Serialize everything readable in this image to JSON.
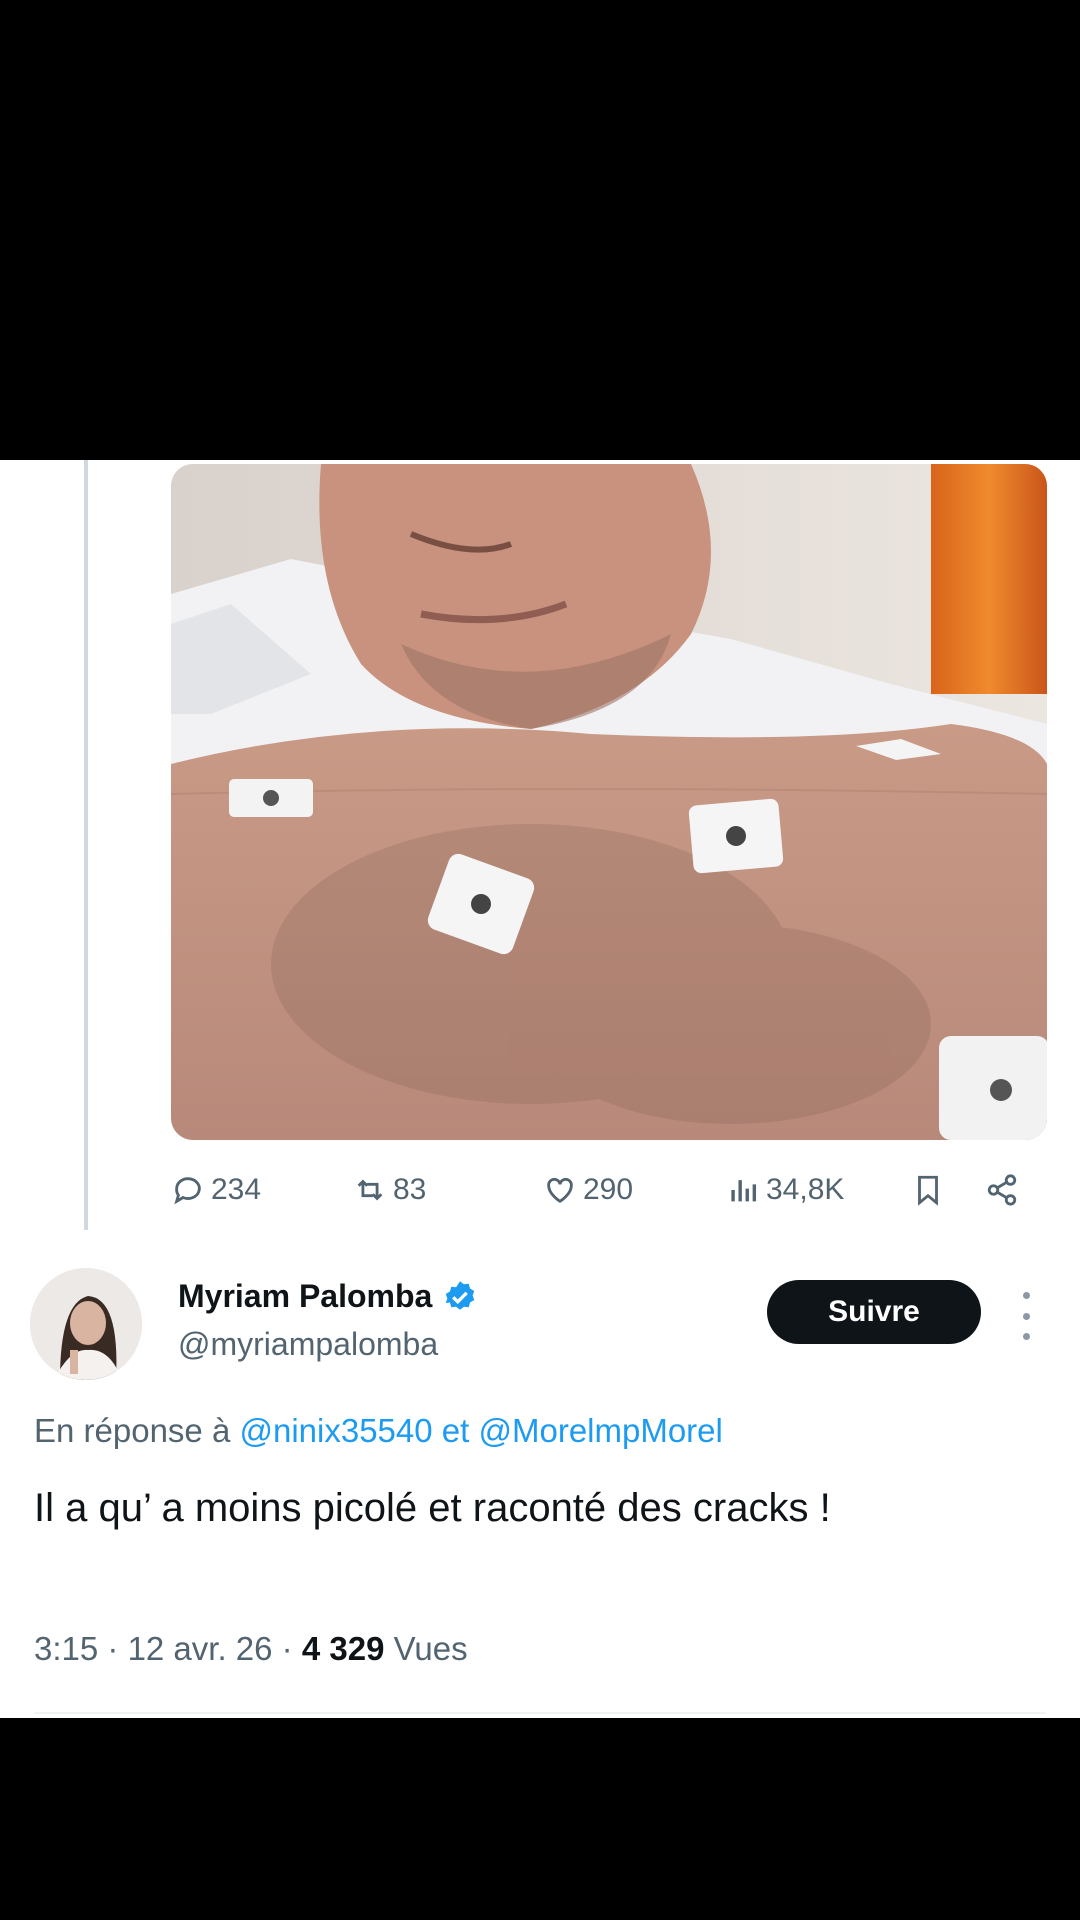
{
  "media": {
    "image_icon": "selfie-ecg-electrodes-photo"
  },
  "actions": {
    "replies": "234",
    "reposts": "83",
    "likes": "290",
    "views": "34,8K"
  },
  "reply_tweet": {
    "author_name": "Myriam Palomba",
    "handle": "@myriampalomba",
    "verified_icon": "verified-badge-icon",
    "follow_label": "Suivre",
    "reply_prefix": "En réponse à ",
    "mention_1": "@ninix35540",
    "connector": " et ",
    "mention_2": "@MorelmpMorel",
    "text": "Il a qu’ a moins picolé et raconté des cracks !",
    "time": "3:15",
    "date": "12 avr. 26",
    "views_count": "4 329",
    "views_label": "Vues"
  },
  "colors": {
    "accent": "#1d9bf0",
    "text_primary": "#0f1419",
    "text_secondary": "#536471"
  }
}
